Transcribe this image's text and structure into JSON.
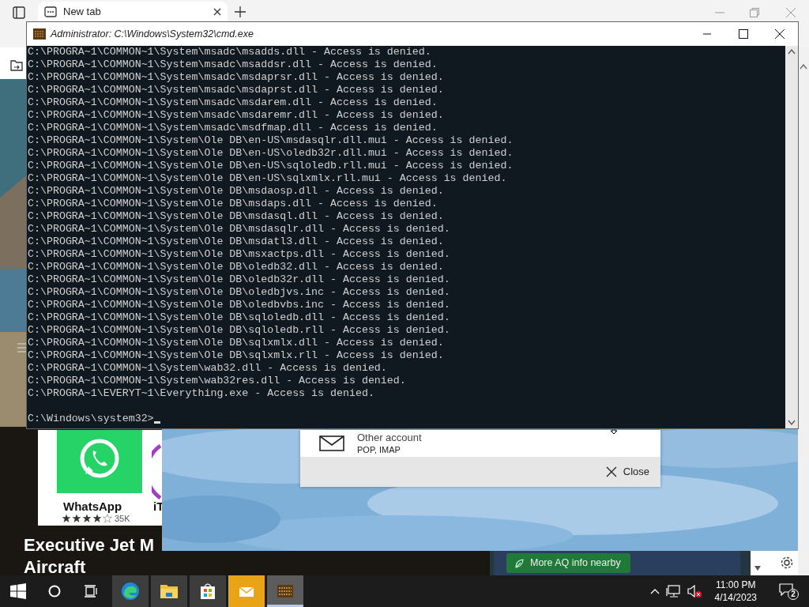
{
  "browser": {
    "tab": {
      "title": "New tab"
    }
  },
  "store": {
    "apps": [
      {
        "name": "WhatsApp",
        "stars": 4,
        "reviews": "35K"
      },
      {
        "name": "iT"
      }
    ],
    "headline": [
      "Executive Jet M",
      "Aircraft"
    ]
  },
  "weather": {
    "aq_button": "More AQ info nearby"
  },
  "dialog": {
    "accounts": [
      {
        "name": "Other account",
        "detail": "POP, IMAP"
      }
    ],
    "close": "Close"
  },
  "console": {
    "title": "Administrator: C:\\Windows\\System32\\cmd.exe",
    "lines": [
      "C:\\PROGRA~1\\COMMON~1\\System\\msadc\\msadds.dll - Access is denied.",
      "C:\\PROGRA~1\\COMMON~1\\System\\msadc\\msaddsr.dll - Access is denied.",
      "C:\\PROGRA~1\\COMMON~1\\System\\msadc\\msdaprsr.dll - Access is denied.",
      "C:\\PROGRA~1\\COMMON~1\\System\\msadc\\msdaprst.dll - Access is denied.",
      "C:\\PROGRA~1\\COMMON~1\\System\\msadc\\msdarem.dll - Access is denied.",
      "C:\\PROGRA~1\\COMMON~1\\System\\msadc\\msdaremr.dll - Access is denied.",
      "C:\\PROGRA~1\\COMMON~1\\System\\msadc\\msdfmap.dll - Access is denied.",
      "C:\\PROGRA~1\\COMMON~1\\System\\Ole DB\\en-US\\msdasqlr.dll.mui - Access is denied.",
      "C:\\PROGRA~1\\COMMON~1\\System\\Ole DB\\en-US\\oledb32r.dll.mui - Access is denied.",
      "C:\\PROGRA~1\\COMMON~1\\System\\Ole DB\\en-US\\sqloledb.rll.mui - Access is denied.",
      "C:\\PROGRA~1\\COMMON~1\\System\\Ole DB\\en-US\\sqlxmlx.rll.mui - Access is denied.",
      "C:\\PROGRA~1\\COMMON~1\\System\\Ole DB\\msdaosp.dll - Access is denied.",
      "C:\\PROGRA~1\\COMMON~1\\System\\Ole DB\\msdaps.dll - Access is denied.",
      "C:\\PROGRA~1\\COMMON~1\\System\\Ole DB\\msdasql.dll - Access is denied.",
      "C:\\PROGRA~1\\COMMON~1\\System\\Ole DB\\msdasqlr.dll - Access is denied.",
      "C:\\PROGRA~1\\COMMON~1\\System\\Ole DB\\msdatl3.dll - Access is denied.",
      "C:\\PROGRA~1\\COMMON~1\\System\\Ole DB\\msxactps.dll - Access is denied.",
      "C:\\PROGRA~1\\COMMON~1\\System\\Ole DB\\oledb32.dll - Access is denied.",
      "C:\\PROGRA~1\\COMMON~1\\System\\Ole DB\\oledb32r.dll - Access is denied.",
      "C:\\PROGRA~1\\COMMON~1\\System\\Ole DB\\oledbjvs.inc - Access is denied.",
      "C:\\PROGRA~1\\COMMON~1\\System\\Ole DB\\oledbvbs.inc - Access is denied.",
      "C:\\PROGRA~1\\COMMON~1\\System\\Ole DB\\sqloledb.dll - Access is denied.",
      "C:\\PROGRA~1\\COMMON~1\\System\\Ole DB\\sqloledb.rll - Access is denied.",
      "C:\\PROGRA~1\\COMMON~1\\System\\Ole DB\\sqlxmlx.dll - Access is denied.",
      "C:\\PROGRA~1\\COMMON~1\\System\\Ole DB\\sqlxmlx.rll - Access is denied.",
      "C:\\PROGRA~1\\COMMON~1\\System\\wab32.dll - Access is denied.",
      "C:\\PROGRA~1\\COMMON~1\\System\\wab32res.dll - Access is denied.",
      "C:\\PROGRA~1\\EVERYT~1\\Everything.exe - Access is denied."
    ],
    "prompt": "C:\\Windows\\system32>"
  },
  "taskbar": {
    "apps": [
      {
        "kind": "edge",
        "selected": false
      },
      {
        "kind": "explorer",
        "selected": false
      },
      {
        "kind": "store",
        "selected": false
      },
      {
        "kind": "mail",
        "selected": false
      },
      {
        "kind": "console",
        "selected": true
      }
    ],
    "volume_muted": true,
    "clock": {
      "time": "11:00 PM",
      "date": "4/14/2023"
    },
    "notifications": "2"
  }
}
